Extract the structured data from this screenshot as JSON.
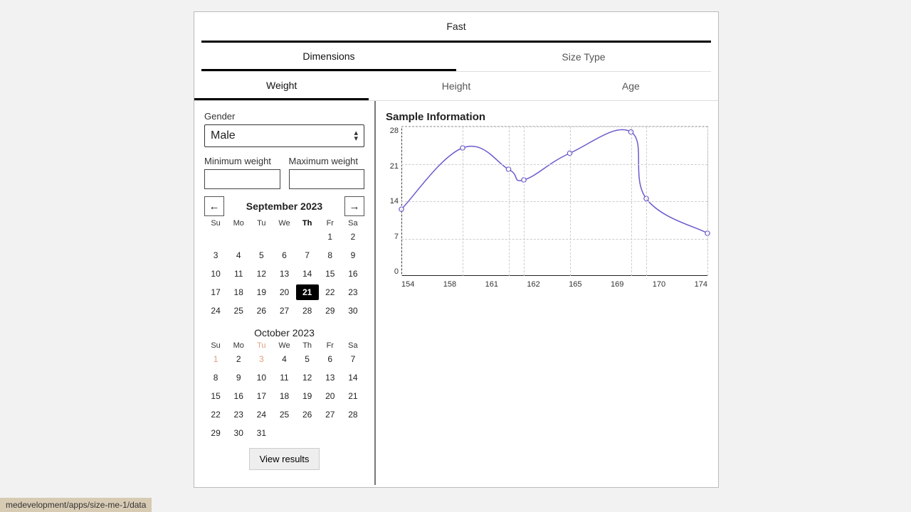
{
  "topbar": {
    "title": "Fast"
  },
  "tabs_primary": {
    "items": [
      "Dimensions",
      "Size Type"
    ],
    "active": 0
  },
  "tabs_secondary": {
    "items": [
      "Weight",
      "Height",
      "Age"
    ],
    "active": 0
  },
  "filters": {
    "gender_label": "Gender",
    "gender_value": "Male",
    "min_label": "Minimum weight",
    "max_label": "Maximum weight",
    "min_value": "",
    "max_value": ""
  },
  "calendar": {
    "month1_title": "September 2023",
    "month2_title": "October 2023",
    "dow": [
      "Su",
      "Mo",
      "Tu",
      "We",
      "Th",
      "Fr",
      "Sa"
    ],
    "today_col": 4,
    "selected_day": 21,
    "month1_leading_blanks": 5,
    "month1_days": 30,
    "month2_days": 31,
    "muted_oct": [
      1,
      3
    ],
    "view_btn": "View results"
  },
  "chart_title": "Sample Information",
  "chart_data": {
    "type": "line",
    "title": "Sample Information",
    "xlabel": "",
    "ylabel": "",
    "ylim": [
      0,
      28
    ],
    "yticks": [
      0,
      7,
      14,
      21,
      28
    ],
    "x": [
      154,
      158,
      161,
      162,
      165,
      169,
      170,
      174
    ],
    "values": [
      12.5,
      24,
      20,
      18,
      23,
      27,
      14.5,
      8
    ]
  },
  "statusbar": "medevelopment/apps/size-me-1/data"
}
